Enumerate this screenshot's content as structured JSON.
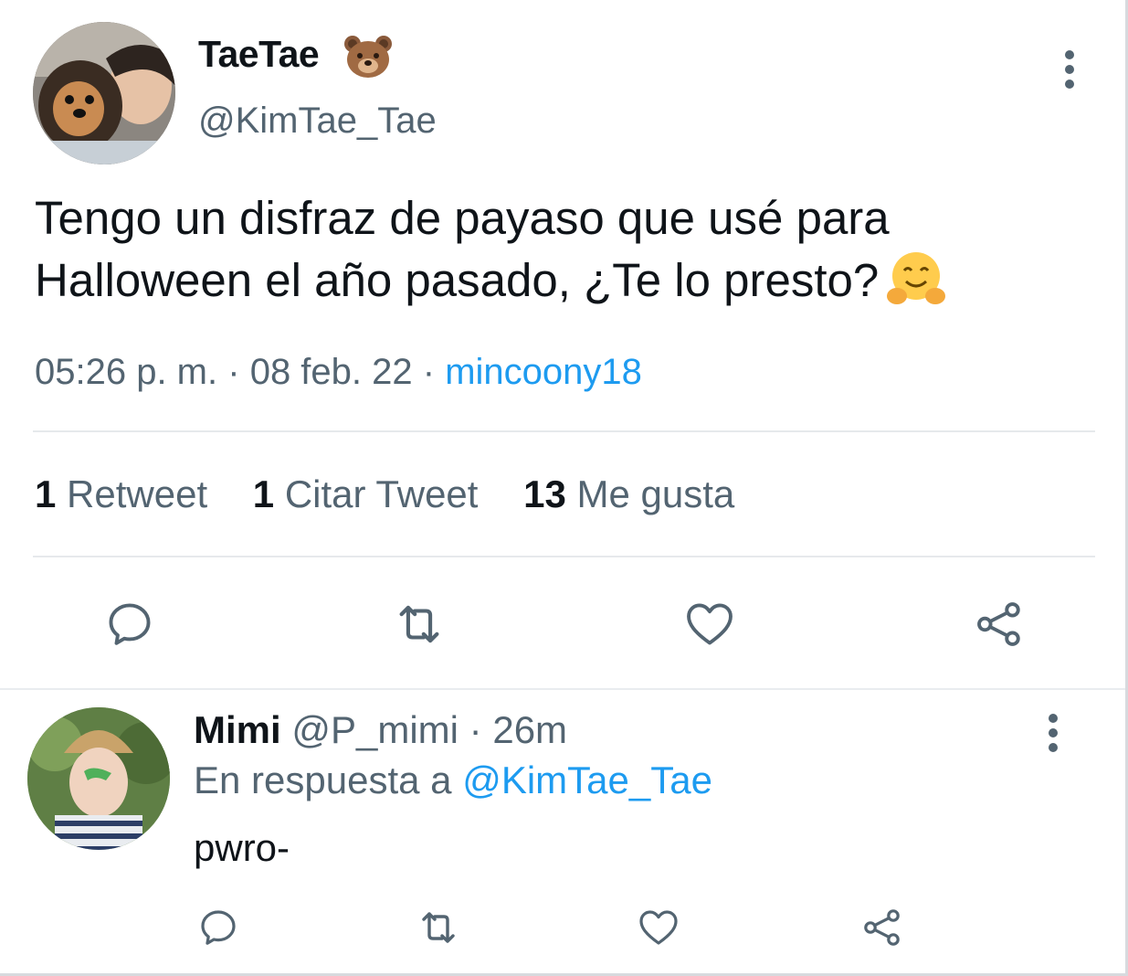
{
  "tweet": {
    "author": {
      "display_name": "TaeTae",
      "name_emoji": "bear-face-emoji",
      "handle": "@KimTae_Tae"
    },
    "text": "Tengo un disfraz de payaso que usé para Halloween el año pasado, ¿Te lo presto?",
    "text_emoji": "hugging-face-emoji",
    "time": "05:26 p. m.",
    "separator": "·",
    "date": "08 feb. 22",
    "source": "mincoony18",
    "stats": {
      "retweets_count": "1",
      "retweets_label": "Retweet",
      "quotes_count": "1",
      "quotes_label": "Citar Tweet",
      "likes_count": "13",
      "likes_label": "Me gusta"
    },
    "actions": [
      "reply-icon",
      "retweet-icon",
      "like-icon",
      "share-icon"
    ]
  },
  "reply": {
    "display_name": "Mimi",
    "handle": "@P_mimi",
    "separator": "·",
    "time": "26m",
    "context_prefix": "En respuesta a",
    "context_mention": "@KimTae_Tae",
    "text": "pwro-"
  },
  "colors": {
    "text_primary": "#0f1419",
    "text_secondary": "#536471",
    "accent": "#1d9bf0",
    "divider": "#e6e9ec"
  }
}
